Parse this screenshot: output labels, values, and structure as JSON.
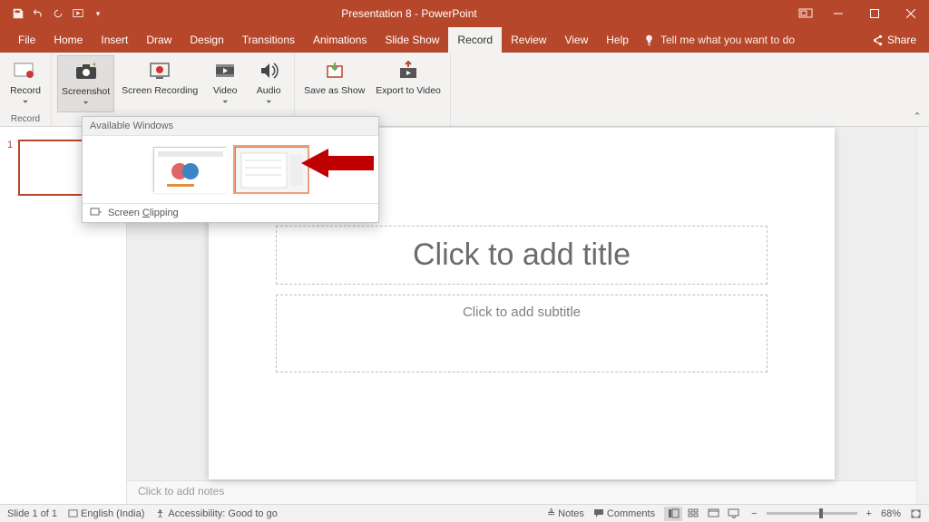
{
  "title": "Presentation 8 - PowerPoint",
  "menu": {
    "file": "File",
    "home": "Home",
    "insert": "Insert",
    "draw": "Draw",
    "design": "Design",
    "transitions": "Transitions",
    "animations": "Animations",
    "slideshow": "Slide Show",
    "record": "Record",
    "review": "Review",
    "view": "View",
    "help": "Help",
    "tellme": "Tell me what you want to do",
    "share": "Share"
  },
  "ribbon": {
    "record": "Record",
    "screenshot": "Screenshot",
    "screen_recording": "Screen Recording",
    "video": "Video",
    "audio": "Audio",
    "save_as_show": "Save as Show",
    "export_to_video": "Export to Video",
    "group_record": "Record"
  },
  "dropdown": {
    "header": "Available Windows",
    "clipping": "Screen Clipping"
  },
  "slide": {
    "title": "Click to add title",
    "subtitle": "Click to add subtitle",
    "notes": "Click to add notes",
    "num": "1"
  },
  "status": {
    "slide_of": "Slide 1 of 1",
    "lang": "English (India)",
    "access": "Accessibility: Good to go",
    "notes": "Notes",
    "comments": "Comments",
    "zoom": "68%"
  }
}
